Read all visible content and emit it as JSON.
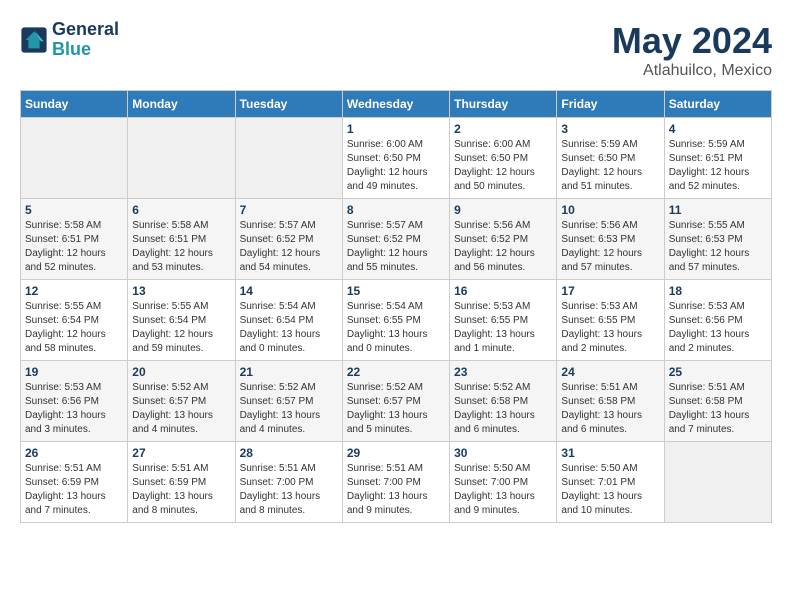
{
  "header": {
    "logo_line1": "General",
    "logo_line2": "Blue",
    "month": "May 2024",
    "location": "Atlahuilco, Mexico"
  },
  "weekdays": [
    "Sunday",
    "Monday",
    "Tuesday",
    "Wednesday",
    "Thursday",
    "Friday",
    "Saturday"
  ],
  "weeks": [
    [
      {
        "day": "",
        "info": ""
      },
      {
        "day": "",
        "info": ""
      },
      {
        "day": "",
        "info": ""
      },
      {
        "day": "1",
        "info": "Sunrise: 6:00 AM\nSunset: 6:50 PM\nDaylight: 12 hours\nand 49 minutes."
      },
      {
        "day": "2",
        "info": "Sunrise: 6:00 AM\nSunset: 6:50 PM\nDaylight: 12 hours\nand 50 minutes."
      },
      {
        "day": "3",
        "info": "Sunrise: 5:59 AM\nSunset: 6:50 PM\nDaylight: 12 hours\nand 51 minutes."
      },
      {
        "day": "4",
        "info": "Sunrise: 5:59 AM\nSunset: 6:51 PM\nDaylight: 12 hours\nand 52 minutes."
      }
    ],
    [
      {
        "day": "5",
        "info": "Sunrise: 5:58 AM\nSunset: 6:51 PM\nDaylight: 12 hours\nand 52 minutes."
      },
      {
        "day": "6",
        "info": "Sunrise: 5:58 AM\nSunset: 6:51 PM\nDaylight: 12 hours\nand 53 minutes."
      },
      {
        "day": "7",
        "info": "Sunrise: 5:57 AM\nSunset: 6:52 PM\nDaylight: 12 hours\nand 54 minutes."
      },
      {
        "day": "8",
        "info": "Sunrise: 5:57 AM\nSunset: 6:52 PM\nDaylight: 12 hours\nand 55 minutes."
      },
      {
        "day": "9",
        "info": "Sunrise: 5:56 AM\nSunset: 6:52 PM\nDaylight: 12 hours\nand 56 minutes."
      },
      {
        "day": "10",
        "info": "Sunrise: 5:56 AM\nSunset: 6:53 PM\nDaylight: 12 hours\nand 57 minutes."
      },
      {
        "day": "11",
        "info": "Sunrise: 5:55 AM\nSunset: 6:53 PM\nDaylight: 12 hours\nand 57 minutes."
      }
    ],
    [
      {
        "day": "12",
        "info": "Sunrise: 5:55 AM\nSunset: 6:54 PM\nDaylight: 12 hours\nand 58 minutes."
      },
      {
        "day": "13",
        "info": "Sunrise: 5:55 AM\nSunset: 6:54 PM\nDaylight: 12 hours\nand 59 minutes."
      },
      {
        "day": "14",
        "info": "Sunrise: 5:54 AM\nSunset: 6:54 PM\nDaylight: 13 hours\nand 0 minutes."
      },
      {
        "day": "15",
        "info": "Sunrise: 5:54 AM\nSunset: 6:55 PM\nDaylight: 13 hours\nand 0 minutes."
      },
      {
        "day": "16",
        "info": "Sunrise: 5:53 AM\nSunset: 6:55 PM\nDaylight: 13 hours\nand 1 minute."
      },
      {
        "day": "17",
        "info": "Sunrise: 5:53 AM\nSunset: 6:55 PM\nDaylight: 13 hours\nand 2 minutes."
      },
      {
        "day": "18",
        "info": "Sunrise: 5:53 AM\nSunset: 6:56 PM\nDaylight: 13 hours\nand 2 minutes."
      }
    ],
    [
      {
        "day": "19",
        "info": "Sunrise: 5:53 AM\nSunset: 6:56 PM\nDaylight: 13 hours\nand 3 minutes."
      },
      {
        "day": "20",
        "info": "Sunrise: 5:52 AM\nSunset: 6:57 PM\nDaylight: 13 hours\nand 4 minutes."
      },
      {
        "day": "21",
        "info": "Sunrise: 5:52 AM\nSunset: 6:57 PM\nDaylight: 13 hours\nand 4 minutes."
      },
      {
        "day": "22",
        "info": "Sunrise: 5:52 AM\nSunset: 6:57 PM\nDaylight: 13 hours\nand 5 minutes."
      },
      {
        "day": "23",
        "info": "Sunrise: 5:52 AM\nSunset: 6:58 PM\nDaylight: 13 hours\nand 6 minutes."
      },
      {
        "day": "24",
        "info": "Sunrise: 5:51 AM\nSunset: 6:58 PM\nDaylight: 13 hours\nand 6 minutes."
      },
      {
        "day": "25",
        "info": "Sunrise: 5:51 AM\nSunset: 6:58 PM\nDaylight: 13 hours\nand 7 minutes."
      }
    ],
    [
      {
        "day": "26",
        "info": "Sunrise: 5:51 AM\nSunset: 6:59 PM\nDaylight: 13 hours\nand 7 minutes."
      },
      {
        "day": "27",
        "info": "Sunrise: 5:51 AM\nSunset: 6:59 PM\nDaylight: 13 hours\nand 8 minutes."
      },
      {
        "day": "28",
        "info": "Sunrise: 5:51 AM\nSunset: 7:00 PM\nDaylight: 13 hours\nand 8 minutes."
      },
      {
        "day": "29",
        "info": "Sunrise: 5:51 AM\nSunset: 7:00 PM\nDaylight: 13 hours\nand 9 minutes."
      },
      {
        "day": "30",
        "info": "Sunrise: 5:50 AM\nSunset: 7:00 PM\nDaylight: 13 hours\nand 9 minutes."
      },
      {
        "day": "31",
        "info": "Sunrise: 5:50 AM\nSunset: 7:01 PM\nDaylight: 13 hours\nand 10 minutes."
      },
      {
        "day": "",
        "info": ""
      }
    ]
  ]
}
